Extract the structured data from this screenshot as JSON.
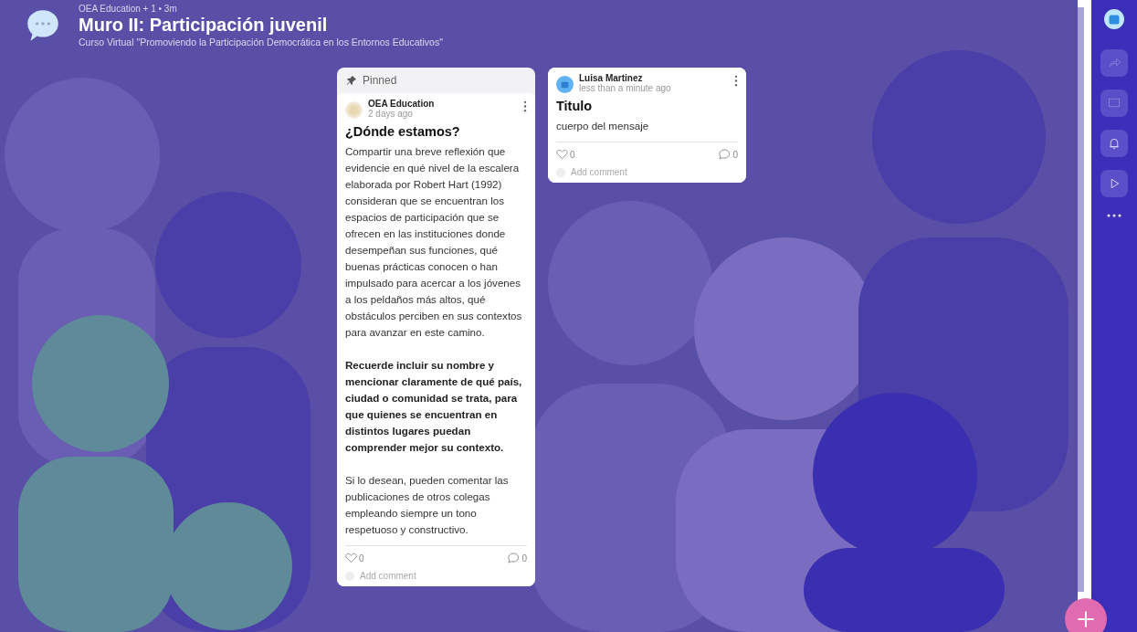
{
  "header": {
    "meta": "OEA Education + 1 • 3m",
    "title": "Muro II: Participación juvenil",
    "subtitle": "Curso Virtual \"Promoviendo la Participación Democrática en los Entornos Educativos\""
  },
  "posts": [
    {
      "pinned": true,
      "pin_label": "Pinned",
      "author": "OEA Education",
      "time": "2 days ago",
      "title": "¿Dónde estamos?",
      "paragraphs": [
        {
          "text": "Compartir una breve reflexión que evidencie en qué nivel de la escalera elaborada por Robert Hart (1992) consideran que se encuentran los espacios de participación que se ofrecen en las instituciones donde desempeñan sus funciones, qué buenas prácticas conocen o han impulsado para acercar a los jóvenes a los peldaños más altos, qué obstáculos perciben en sus contextos para avanzar en este camino.",
          "bold": false
        },
        {
          "text": "Recuerde incluir su nombre y mencionar claramente de qué país, ciudad o comunidad se trata, para que quienes se encuentran en distintos lugares puedan comprender mejor su contexto.",
          "bold": true
        },
        {
          "text": "Si lo desean, pueden comentar las publicaciones de otros colegas empleando siempre un tono respetuoso y constructivo.",
          "bold": false
        }
      ],
      "likes": "0",
      "comments": "0",
      "add_comment": "Add comment"
    },
    {
      "pinned": false,
      "author": "Luisa Martinez",
      "time": "less than a minute ago",
      "title": "Titulo",
      "paragraphs": [
        {
          "text": "cuerpo del mensaje",
          "bold": false
        }
      ],
      "likes": "0",
      "comments": "0",
      "add_comment": "Add comment"
    }
  ]
}
